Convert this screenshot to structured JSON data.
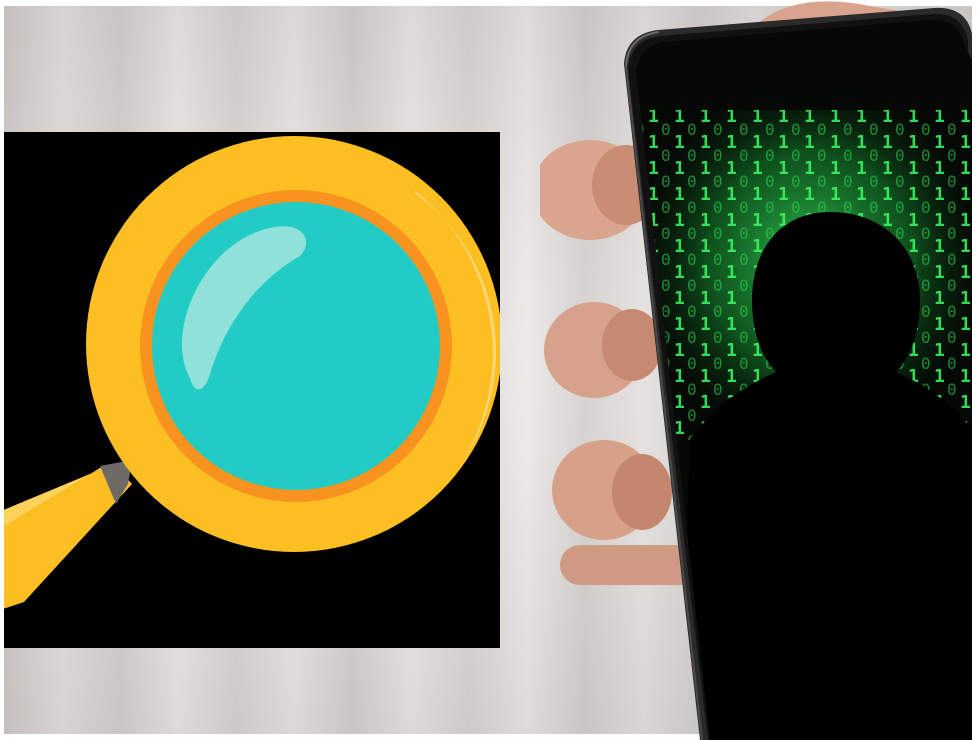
{
  "scene": {
    "left_graphic": "magnifying-glass-icon",
    "right_graphic": "hooded-hacker-on-phone",
    "colors": {
      "lens_rim": "#fbbf23",
      "lens_inner_ring": "#f7931e",
      "lens_glass": "#22cbc4",
      "lens_highlight": "#8fe1d9",
      "card_background": "#000000",
      "code_green": "#3dfc64",
      "skin": "#d9a58e"
    }
  }
}
